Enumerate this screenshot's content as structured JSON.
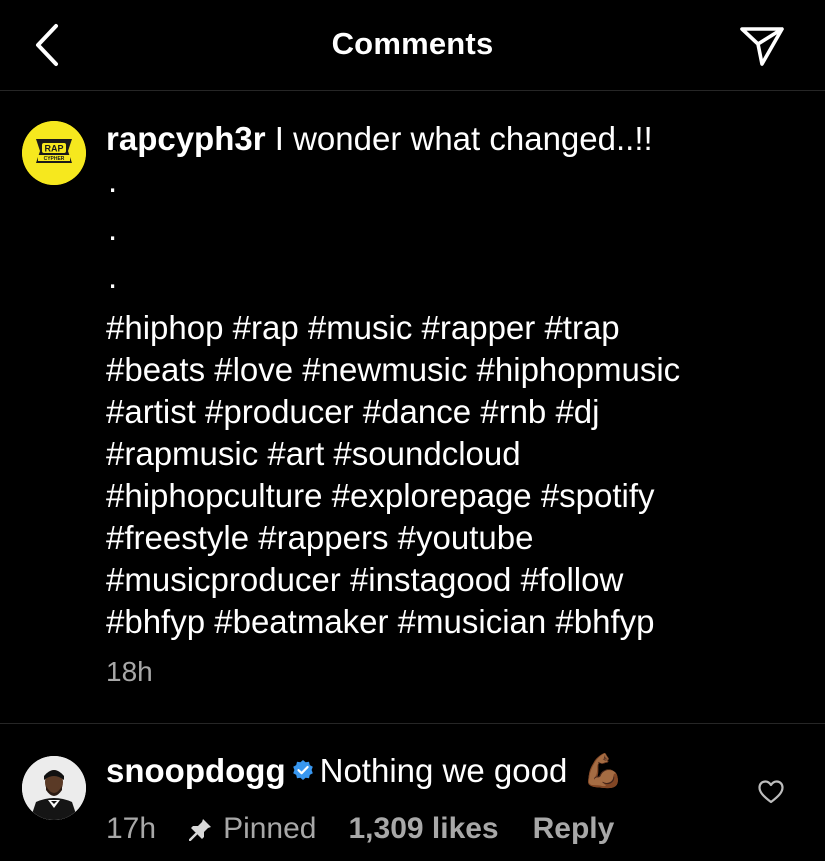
{
  "header": {
    "title": "Comments",
    "back_icon": "chevron-left-icon",
    "share_icon": "send-icon"
  },
  "caption": {
    "username": "rapcyph3r",
    "text": "I wonder what changed..!!",
    "dots": [
      ".",
      ".",
      "."
    ],
    "hashtag_lines": [
      "#hiphop #rap #music #rapper #trap",
      "#beats #love #newmusic #hiphopmusic",
      "#artist #producer #dance #rnb #dj",
      "#rapmusic #art #soundcloud",
      "#hiphopculture #explorepage #spotify",
      "#freestyle #rappers #youtube",
      "#musicproducer #instagood #follow",
      "#bhfyp #beatmaker #musician #bhfyp"
    ],
    "time": "18h",
    "avatar": {
      "logo_text": "RAP",
      "logo_sub": "CYPHER",
      "colors": {
        "bg": "#f6e81e",
        "dark": "#1a1a1a"
      }
    }
  },
  "comment": {
    "username": "snoopdogg",
    "verified": true,
    "text": "Nothing we good",
    "emoji": "💪🏾",
    "time": "17h",
    "pinned_label": "Pinned",
    "likes": "1,309 likes",
    "reply": "Reply",
    "heart_icon": "heart-outline-icon"
  },
  "colors": {
    "background": "#000000",
    "text": "#ffffff",
    "secondary": "#a8a8a8",
    "divider": "#262626",
    "verified": "#3897f0"
  }
}
